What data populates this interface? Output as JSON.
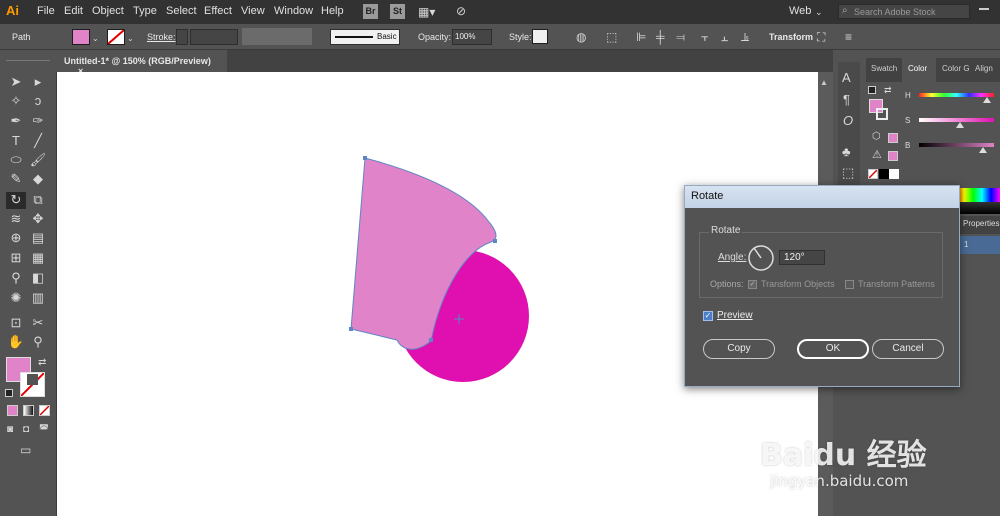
{
  "app": {
    "logo": "Ai"
  },
  "menubar": {
    "items": [
      "File",
      "Edit",
      "Object",
      "Type",
      "Select",
      "Effect",
      "View",
      "Window",
      "Help"
    ],
    "bridge": "Br",
    "stock": "St",
    "workspace": "Web",
    "search_placeholder": "Search Adobe Stock"
  },
  "control": {
    "selection_type": "Path",
    "stroke_label": "Stroke:",
    "brush": "Basic",
    "opacity_label": "Opacity:",
    "opacity_value": "100%",
    "style_label": "Style:",
    "transform_label": "Transform"
  },
  "document": {
    "tab_title": "Untitled-1* @ 150% (RGB/Preview)",
    "close": "×"
  },
  "panels": {
    "tabs": [
      "Swatch",
      "Color",
      "Color G",
      "Align"
    ],
    "sliders": [
      {
        "label": "H",
        "value": 0.9
      },
      {
        "label": "S",
        "value": 0.55
      },
      {
        "label": "B",
        "value": 0.85
      }
    ],
    "properties_label": "Properties",
    "layer_num": "1"
  },
  "dialog": {
    "title": "Rotate",
    "group_label": "Rotate",
    "angle_label": "Angle:",
    "angle_value": "120°",
    "options_label": "Options:",
    "transform_objects": "Transform Objects",
    "transform_patterns": "Transform Patterns",
    "preview_label": "Preview",
    "copy_button": "Copy",
    "ok_button": "OK",
    "cancel_button": "Cancel"
  },
  "watermark": {
    "text": "Baidu 经验",
    "url": "jingyan.baidu.com"
  },
  "colors": {
    "fill": "#e083c8",
    "circle": "#e010b0",
    "accent": "#5d86c5"
  }
}
